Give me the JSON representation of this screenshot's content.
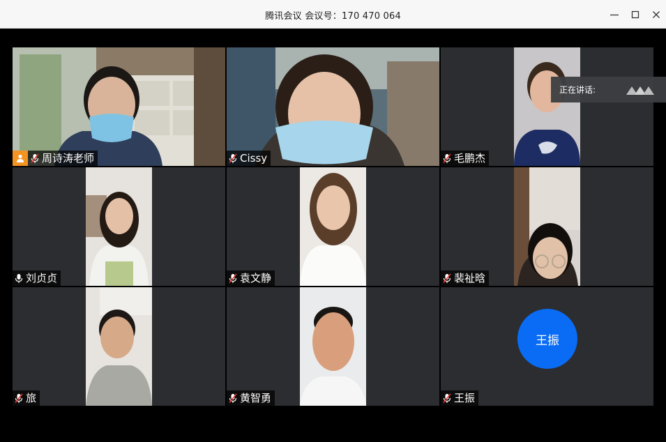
{
  "window": {
    "title": "腾讯会议 会议号：170 470 064"
  },
  "speaking": {
    "label": "正在讲话:"
  },
  "participants": [
    {
      "name": "周诗涛老师",
      "host": true,
      "mic": "muted"
    },
    {
      "name": "Cissy",
      "host": false,
      "mic": "muted"
    },
    {
      "name": "毛鹏杰",
      "host": false,
      "mic": "muted"
    },
    {
      "name": "刘贞贞",
      "host": false,
      "mic": "on"
    },
    {
      "name": "袁文静",
      "host": false,
      "mic": "muted"
    },
    {
      "name": "裴祉晗",
      "host": false,
      "mic": "muted"
    },
    {
      "name": "旅",
      "host": false,
      "mic": "muted"
    },
    {
      "name": "黄智勇",
      "host": false,
      "mic": "muted"
    },
    {
      "name": "王振",
      "host": false,
      "mic": "muted",
      "video": false,
      "avatar_text": "王振"
    }
  ],
  "colors": {
    "host_badge": "#f39322",
    "avatar": "#0a6cf5",
    "muted_slash": "#e8332b",
    "tile_bg": "#2b2d31"
  },
  "icons": {
    "minimize": "minimize-icon",
    "maximize": "maximize-icon",
    "close": "close-icon",
    "mic": "mic-icon",
    "mic_muted": "mic-muted-icon",
    "host": "host-icon"
  }
}
